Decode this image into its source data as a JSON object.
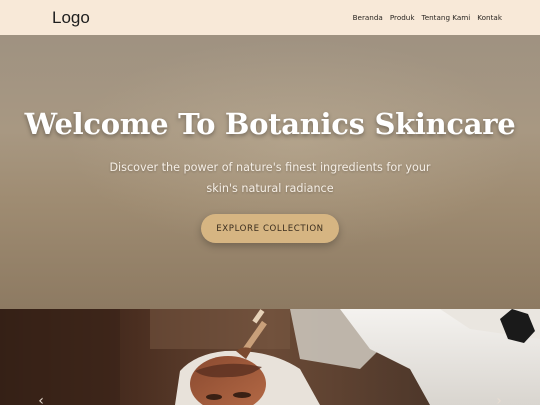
{
  "navbar": {
    "logo": "Logo",
    "links": [
      "Beranda",
      "Produk",
      "Tentang Kami",
      "Kontak"
    ]
  },
  "hero": {
    "title": "Welcome To Botanics Skincare",
    "subtitle": "Discover the power of nature's finest ingredients for your skin's natural radiance",
    "cta_label": "EXPLORE COLLECTION"
  },
  "carousel": {
    "prev_icon": "chevron-left-icon",
    "next_icon": "chevron-right-icon",
    "prev_glyph": "‹",
    "next_glyph": "›"
  },
  "colors": {
    "navbar_bg": "#f8e9d8",
    "cta_bg": "#d6b582",
    "hero_text": "#ffffff"
  }
}
